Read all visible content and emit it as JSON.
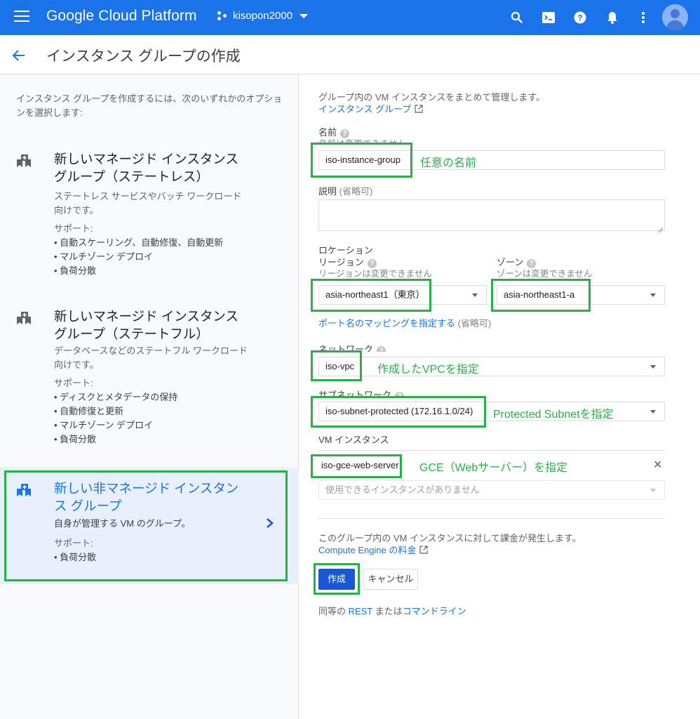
{
  "topbar": {
    "brand": "Google Cloud Platform",
    "project": "kisopon2000",
    "icons": [
      "search-icon",
      "cloud-shell-icon",
      "help-icon",
      "notifications-icon",
      "more-vert-icon",
      "account-avatar"
    ]
  },
  "header": {
    "title": "インスタンス グループの作成"
  },
  "left": {
    "intro": "インスタンス グループを作成するには、次のいずれかのオプションを選択します:",
    "options": [
      {
        "title": "新しいマネージド インスタンス グループ（ステートレス）",
        "desc": "ステートレス サービスやバッチ ワークロード向けです。",
        "support_label": "サポート:",
        "support": [
          "自動スケーリング、自動修復、自動更新",
          "マルチゾーン デプロイ",
          "負荷分散"
        ],
        "selected": false
      },
      {
        "title": "新しいマネージド インスタンス グループ（ステートフル）",
        "desc": "データベースなどのステートフル ワークロード向けです。",
        "support_label": "サポート:",
        "support": [
          "ディスクとメタデータの保持",
          "自動修復と更新",
          "マルチゾーン デプロイ",
          "負荷分散"
        ],
        "selected": false
      },
      {
        "title": "新しい非マネージド インスタンス グループ",
        "desc": "自身が管理する VM のグループ。",
        "support_label": "サポート:",
        "support": [
          "負荷分散"
        ],
        "selected": true
      }
    ]
  },
  "form": {
    "intro": "グループ内の VM インスタンスをまとめて管理します。",
    "intro_link": "インスタンス グループ",
    "name": {
      "label": "名前",
      "sub": "名前は変更できません。",
      "value": "iso-instance-group",
      "annotation": "任意の名前"
    },
    "description": {
      "label": "説明",
      "optional": "(省略可)",
      "value": ""
    },
    "location": {
      "label": "ロケーション",
      "region_label": "リージョン",
      "region_sub": "リージョンは変更できません",
      "region_value": "asia-northeast1（東京）",
      "zone_label": "ゾーン",
      "zone_sub": "ゾーンは変更できません",
      "zone_value": "asia-northeast1-a"
    },
    "port_mapping_link": "ポート名のマッピングを指定する",
    "port_mapping_optional": "(省略可)",
    "network": {
      "label": "ネットワーク",
      "value": "iso-vpc",
      "annotation": "作成したVPCを指定"
    },
    "subnetwork": {
      "label": "サブネットワーク",
      "value": "iso-subnet-protected (172.16.1.0/24)",
      "annotation": "Protected Subnetを指定"
    },
    "vm_instances": {
      "label": "VM インスタンス",
      "items": [
        "iso-gce-web-server"
      ],
      "annotation": "GCE（Webサーバー）を指定",
      "add_placeholder": "使用できるインスタンスがありません"
    },
    "billing_note": "このグループ内の VM インスタンスに対して課金が発生します。",
    "billing_link": "Compute Engine の料金",
    "create_label": "作成",
    "cancel_label": "キャンセル",
    "equivalent_prefix": "同等の",
    "rest_link": "REST",
    "or_text": " または",
    "cli_link": "コマンドライン"
  },
  "colors": {
    "brand_blue": "#1a73e8",
    "primary_button": "#1a57d6",
    "annotation_green": "#28b246",
    "selected_bg": "#e8f0fe"
  }
}
